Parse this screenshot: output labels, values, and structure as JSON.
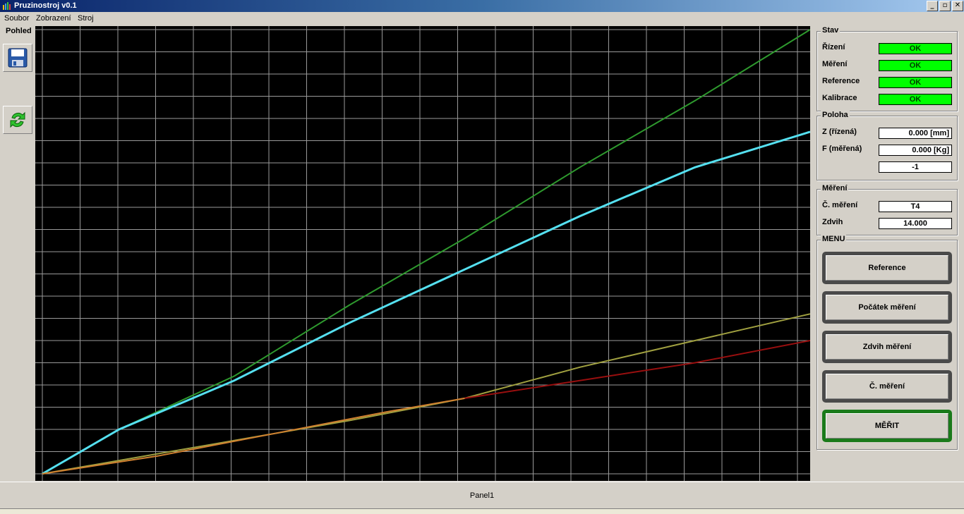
{
  "window": {
    "title": "Pruzinostroj v0.1",
    "buttons": {
      "minimize": "_",
      "restore": "▫",
      "close": "✕"
    }
  },
  "menu": [
    "Soubor",
    "Zobrazení",
    "Stroj"
  ],
  "left_panel": {
    "label": "Pohled",
    "buttons": [
      {
        "icon": "save-icon"
      },
      {
        "icon": "refresh-icon"
      }
    ]
  },
  "stav": {
    "title": "Stav",
    "items": [
      {
        "label": "Řízení",
        "value": "OK"
      },
      {
        "label": "Měření",
        "value": "OK"
      },
      {
        "label": "Reference",
        "value": "OK"
      },
      {
        "label": "Kalibrace",
        "value": "OK"
      }
    ],
    "ok_color": "#00ff00"
  },
  "poloha": {
    "title": "Poloha",
    "z_label": "Z (řízená)",
    "z_value": "0.000 [mm]",
    "f_label": "F (měřená)",
    "f_value": "0.000 [Kg]",
    "extra_value": "-1"
  },
  "mereni": {
    "title": "Měření",
    "c_label": "Č. měření",
    "c_value": "T4",
    "zdvih_label": "Zdvih",
    "zdvih_value": "14.000"
  },
  "menu_panel": {
    "title": "MENU",
    "buttons": [
      "Reference",
      "Počátek měření",
      "Zdvih měření",
      "Č. měření",
      "MĚŘIT"
    ]
  },
  "status": {
    "panel_text": "Panel1"
  },
  "chart_data": {
    "type": "line",
    "grid": true,
    "background": "#000000",
    "xlim": [
      0,
      1
    ],
    "ylim": [
      0,
      1
    ],
    "series": [
      {
        "color": "#2e9a2e",
        "x": [
          0,
          0.1,
          0.25,
          0.4,
          0.55,
          0.7,
          0.85,
          1
        ],
        "y": [
          0,
          0.1,
          0.22,
          0.38,
          0.53,
          0.69,
          0.84,
          1
        ]
      },
      {
        "color": "#55e0f0",
        "x": [
          0,
          0.1,
          0.25,
          0.4,
          0.55,
          0.7,
          0.85,
          1
        ],
        "y": [
          0,
          0.1,
          0.21,
          0.34,
          0.46,
          0.58,
          0.69,
          0.77
        ]
      },
      {
        "color": "#a0a040",
        "x": [
          0,
          0.2,
          0.4,
          0.55,
          0.7,
          0.85,
          1
        ],
        "y": [
          0,
          0.06,
          0.12,
          0.17,
          0.24,
          0.3,
          0.36
        ]
      },
      {
        "color": "#990f0f",
        "x": [
          0.55,
          0.7,
          0.85,
          1
        ],
        "y": [
          0.17,
          0.21,
          0.25,
          0.3
        ]
      },
      {
        "color": "#d08030",
        "x": [
          0,
          0.15,
          0.3,
          0.45,
          0.55
        ],
        "y": [
          0,
          0.04,
          0.09,
          0.14,
          0.17
        ]
      }
    ]
  }
}
